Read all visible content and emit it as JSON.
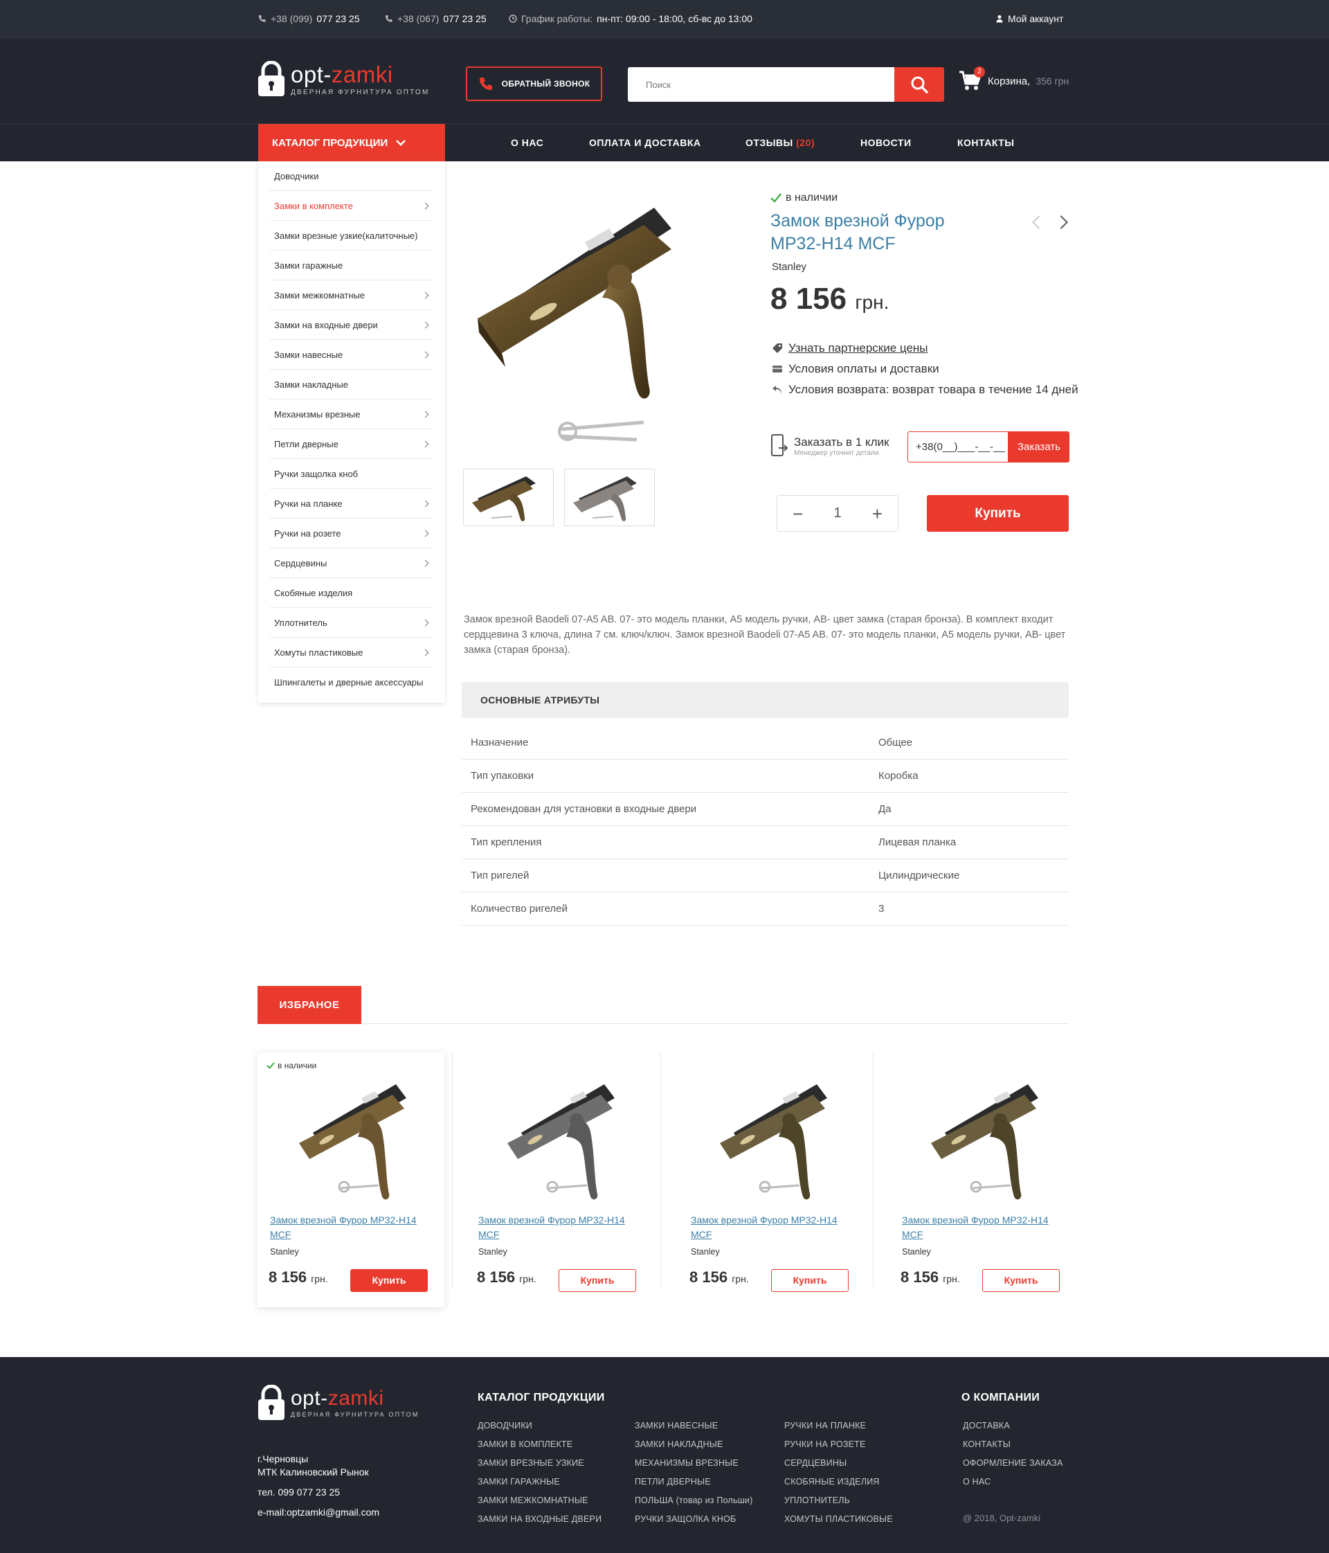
{
  "topbar": {
    "phone1_prefix": "+38 (099)",
    "phone1": "077 23 25",
    "phone2_prefix": "+38 (067)",
    "phone2": "077 23 25",
    "schedule_label": "График работы:",
    "schedule": "пн-пт: 09:00 - 18:00, сб-вс до 13:00",
    "account": "Мой аккаунт"
  },
  "header": {
    "brand_a": "opt-",
    "brand_b": "zamki",
    "tagline": "ДВЕРНАЯ ФУРНИТУРА ОПТОМ",
    "callback": "ОБРАТНЫЙ ЗВОНОК",
    "search_placeholder": "Поиск",
    "cart_count": "2",
    "cart_label": "Корзина,",
    "cart_sum": "356 грн"
  },
  "nav": {
    "catalog": "КАТАЛОГ ПРОДУКЦИИ",
    "links": [
      "О НАС",
      "ОПЛАТА И ДОСТАВКА",
      "ОТЗЫВЫ",
      "НОВОСТИ",
      "КОНТАКТЫ"
    ],
    "reviews_count": "(20)"
  },
  "sidebar": {
    "items": [
      {
        "label": "Доводчики",
        "sub": false
      },
      {
        "label": "Замки в комплекте",
        "sub": true,
        "active": true
      },
      {
        "label": "Замки врезные узкие(калиточные)",
        "sub": false
      },
      {
        "label": "Замки гаражные",
        "sub": false
      },
      {
        "label": "Замки межкомнатные",
        "sub": true
      },
      {
        "label": "Замки на входные двери",
        "sub": true
      },
      {
        "label": "Замки навесные",
        "sub": true
      },
      {
        "label": "Замки накладные",
        "sub": false
      },
      {
        "label": "Механизмы врезные",
        "sub": true
      },
      {
        "label": "Петли дверные",
        "sub": true
      },
      {
        "label": "Ручки защолка кноб",
        "sub": false
      },
      {
        "label": "Ручки на планке",
        "sub": true
      },
      {
        "label": "Ручки на розете",
        "sub": true
      },
      {
        "label": "Сердцевины",
        "sub": true
      },
      {
        "label": "Скобяные изделия",
        "sub": false
      },
      {
        "label": "Уплотнитель",
        "sub": true
      },
      {
        "label": "Хомуты пластиковые",
        "sub": true
      },
      {
        "label": "Шпингалеты и дверные аксессуары",
        "sub": false
      }
    ]
  },
  "product": {
    "stock": "в наличии",
    "title": "Замок врезной Фурор МР32-Н14 MCF",
    "brand": "Stanley",
    "price": "8 156",
    "currency": "грн.",
    "partner_prices": "Узнать партнерские цены",
    "payment": "Условия оплаты и доставки",
    "returns": "Условия возврата: возврат товара в течение 14 дней",
    "oneclick_label": "Заказать в 1 клик",
    "oneclick_sub": "Менеджер уточнит детали.",
    "phone_mask": "+38(0__)___-__-__",
    "order_btn": "Заказать",
    "qty": "1",
    "buy": "Купить",
    "description": "Замок врезной Baodeli 07-A5 AB. 07- это модель планки, А5 модель ручки, АВ- цвет замка (старая бронза). В комплект входит сердцевина 3 ключа, длина 7 см. ключ/ключ.  Замок врезной Baodeli 07-A5 AB. 07- это модель планки, А5 модель ручки, АВ- цвет замка (старая бронза)."
  },
  "attributes": {
    "heading": "ОСНОВНЫЕ АТРИБУТЫ",
    "rows": [
      {
        "k": "Назначение",
        "v": "Общее"
      },
      {
        "k": "Тип упаковки",
        "v": "Коробка"
      },
      {
        "k": "Рекомендован для установки в входные двери",
        "v": "Да"
      },
      {
        "k": "Тип крепления",
        "v": "Лицевая планка"
      },
      {
        "k": "Тип ригелей",
        "v": "Цилиндрические"
      },
      {
        "k": "Количество ригелей",
        "v": "3"
      }
    ]
  },
  "favorites": {
    "tab": "ИЗБРАНОЕ",
    "cards": [
      {
        "stock": "в наличии",
        "name": "Замок врезной Фурор МР32-Н14 MCF",
        "brand": "Stanley",
        "price": "8 156",
        "currency": "грн.",
        "buy": "Купить"
      },
      {
        "stock": "",
        "name": "Замок врезной Фурор МР32-Н14 MCF",
        "brand": "Stanley",
        "price": "8 156",
        "currency": "грн.",
        "buy": "Купить"
      },
      {
        "stock": "",
        "name": "Замок врезной Фурор МР32-Н14 MCF",
        "brand": "Stanley",
        "price": "8 156",
        "currency": "грн.",
        "buy": "Купить"
      },
      {
        "stock": "",
        "name": "Замок врезной Фурор МР32-Н14 MCF",
        "brand": "Stanley",
        "price": "8 156",
        "currency": "грн.",
        "buy": "Купить"
      }
    ]
  },
  "footer": {
    "city": "г.Черновцы",
    "market": "МТК Калиновский Рынок",
    "phone": "тел. 099 077 23 25",
    "email": "e-mail:optzamki@gmail.com",
    "catalog_title": "КАТАЛОГ ПРОДУКЦИИ",
    "col1": [
      "ДОВОДЧИКИ",
      "ЗАМКИ В КОМПЛЕКТЕ",
      "ЗАМКИ ВРЕЗНЫЕ УЗКИЕ",
      "ЗАМКИ ГАРАЖНЫЕ",
      "ЗАМКИ МЕЖКОМНАТНЫЕ",
      "ЗАМКИ НА ВХОДНЫЕ ДВЕРИ"
    ],
    "col2": [
      "ЗАМКИ НАВЕСНЫЕ",
      "ЗАМКИ НАКЛАДНЫЕ",
      "МЕХАНИЗМЫ ВРЕЗНЫЕ",
      "ПЕТЛИ ДВЕРНЫЕ",
      "ПОЛЬША (товар из Польши)",
      "РУЧКИ ЗАЩОЛКА КНОБ"
    ],
    "col3": [
      "РУЧКИ НА ПЛАНКЕ",
      "РУЧКИ НА РОЗЕТЕ",
      "СЕРДЦЕВИНЫ",
      "СКОБЯНЫЕ ИЗДЕЛИЯ",
      "УПЛОТНИТЕЛЬ",
      "ХОМУТЫ ПЛАСТИКОВЫЕ"
    ],
    "company_title": "О КОМПАНИИ",
    "col4": [
      "ДОСТАВКА",
      "КОНТАКТЫ",
      "ОФОРМЛЕНИЕ ЗАКАЗА",
      "О НАС"
    ],
    "copyright": "@ 2018, Opt-zamki"
  },
  "colors": {
    "accent": "#ea3a2e",
    "dark": "#23262e",
    "topbar": "#2a2e36",
    "link": "#3b7fa6"
  }
}
